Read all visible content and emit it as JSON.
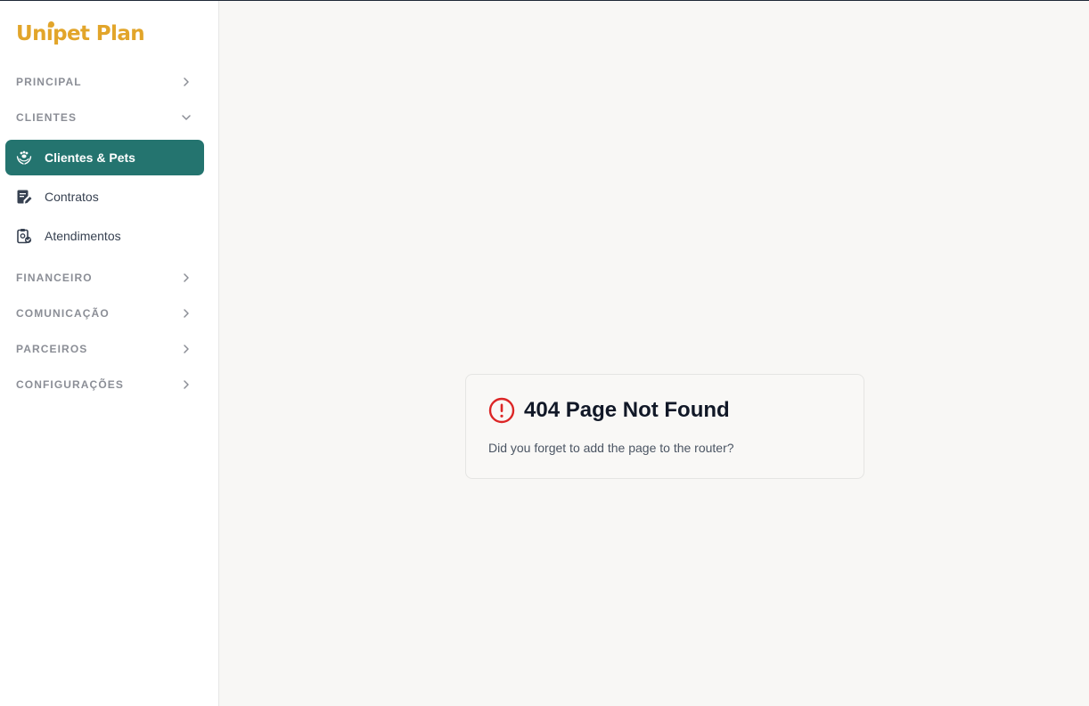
{
  "brand": {
    "name": "Unipet Plan",
    "color": "#e2a52a"
  },
  "sidebar": {
    "sections": [
      {
        "label": "PRINCIPAL",
        "state": "collapsed"
      },
      {
        "label": "CLIENTES",
        "state": "expanded"
      },
      {
        "label": "FINANCEIRO",
        "state": "collapsed"
      },
      {
        "label": "COMUNICAÇÃO",
        "state": "collapsed"
      },
      {
        "label": "PARCEIROS",
        "state": "collapsed"
      },
      {
        "label": "CONFIGURAÇÕES",
        "state": "collapsed"
      }
    ],
    "items": [
      {
        "label": "Clientes & Pets",
        "icon": "pet-hands-icon",
        "active": true
      },
      {
        "label": "Contratos",
        "icon": "document-edit-icon",
        "active": false
      },
      {
        "label": "Atendimentos",
        "icon": "clipboard-check-icon",
        "active": false
      }
    ],
    "active_color": "#24746f"
  },
  "error": {
    "icon": "alert-circle-icon",
    "title": "404 Page Not Found",
    "message": "Did you forget to add the page to the router?",
    "icon_color": "#dc2626"
  }
}
